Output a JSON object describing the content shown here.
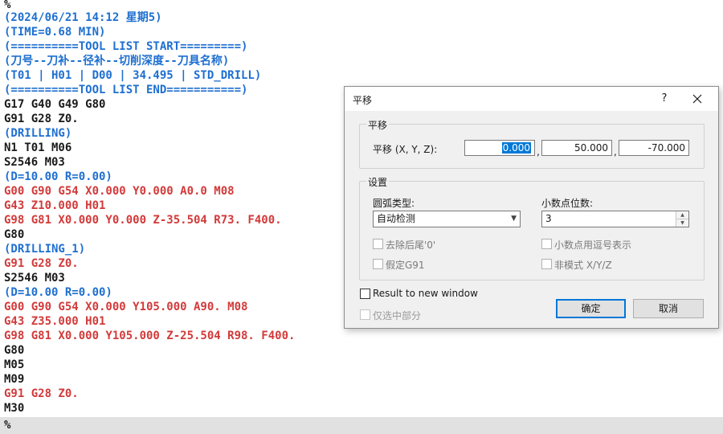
{
  "editor": {
    "top_line": "%",
    "lines": [
      {
        "text": "(2024/06/21 14:12 星期5)",
        "color": "blue"
      },
      {
        "text": "(TIME=0.68 MIN)",
        "color": "blue"
      },
      {
        "text": "(==========TOOL LIST START=========)",
        "color": "blue"
      },
      {
        "text": "(刀号--刀补--径补--切削深度--刀具名称)",
        "color": "blue"
      },
      {
        "text": "(T01 | H01 | D00 | 34.495 | STD_DRILL)",
        "color": "blue"
      },
      {
        "text": "(==========TOOL LIST END===========)",
        "color": "blue"
      },
      {
        "text": "G17 G40 G49 G80",
        "color": "black"
      },
      {
        "text": "G91 G28 Z0.",
        "color": "black"
      },
      {
        "text": "(DRILLING)",
        "color": "blue"
      },
      {
        "text": "N1 T01 M06",
        "color": "black"
      },
      {
        "text": "S2546 M03",
        "color": "black"
      },
      {
        "text": "(D=10.00 R=0.00)",
        "color": "blue"
      },
      {
        "text": "G00 G90 G54 X0.000 Y0.000 A0.0 M08",
        "color": "red"
      },
      {
        "text": "G43 Z10.000 H01",
        "color": "red"
      },
      {
        "text": "G98 G81 X0.000 Y0.000 Z-35.504 R73. F400.",
        "color": "red"
      },
      {
        "text": "G80",
        "color": "black"
      },
      {
        "text": "(DRILLING_1)",
        "color": "blue"
      },
      {
        "text": "G91 G28 Z0.",
        "color": "red"
      },
      {
        "text": "S2546 M03",
        "color": "black"
      },
      {
        "text": "(D=10.00 R=0.00)",
        "color": "blue"
      },
      {
        "text": "G00 G90 G54 X0.000 Y105.000 A90. M08",
        "color": "red"
      },
      {
        "text": "G43 Z35.000 H01",
        "color": "red"
      },
      {
        "text": "G98 G81 X0.000 Y105.000 Z-25.504 R98. F400.",
        "color": "red"
      },
      {
        "text": "G80",
        "color": "black"
      },
      {
        "text": "M05",
        "color": "black"
      },
      {
        "text": "M09",
        "color": "black"
      },
      {
        "text": "G91 G28 Z0.",
        "color": "red"
      },
      {
        "text": "M30",
        "color": "black"
      }
    ],
    "bottom_line": "%",
    "colors": {
      "blue": "#1e6fd0",
      "black": "#1a1a1a",
      "red": "#d23a3a",
      "bottom_bar": "#e1e1e1"
    }
  },
  "dialog": {
    "title": "平移",
    "help_label": "?",
    "close_icon": "close-icon",
    "translate_group": {
      "label": "平移",
      "field_label": "平移 (X, Y, Z):",
      "x_value": "0.000",
      "y_value": "50.000",
      "z_value": "-70.000",
      "separator": ","
    },
    "settings_group": {
      "label": "设置",
      "arc_type_label": "圆弧类型:",
      "arc_type_value": "自动检测",
      "decimals_label": "小数点位数:",
      "decimals_value": "3",
      "remove_trailing_zero": "去除后尾'0'",
      "decimal_comma": "小数点用逗号表示",
      "assume_g91": "假定G91",
      "non_modal_xyz": "非模式 X/Y/Z"
    },
    "result_to_new_window": "Result to new window",
    "selected_only": "仅选中部分",
    "ok_label": "确定",
    "cancel_label": "取消",
    "accent_color": "#0078d7"
  }
}
